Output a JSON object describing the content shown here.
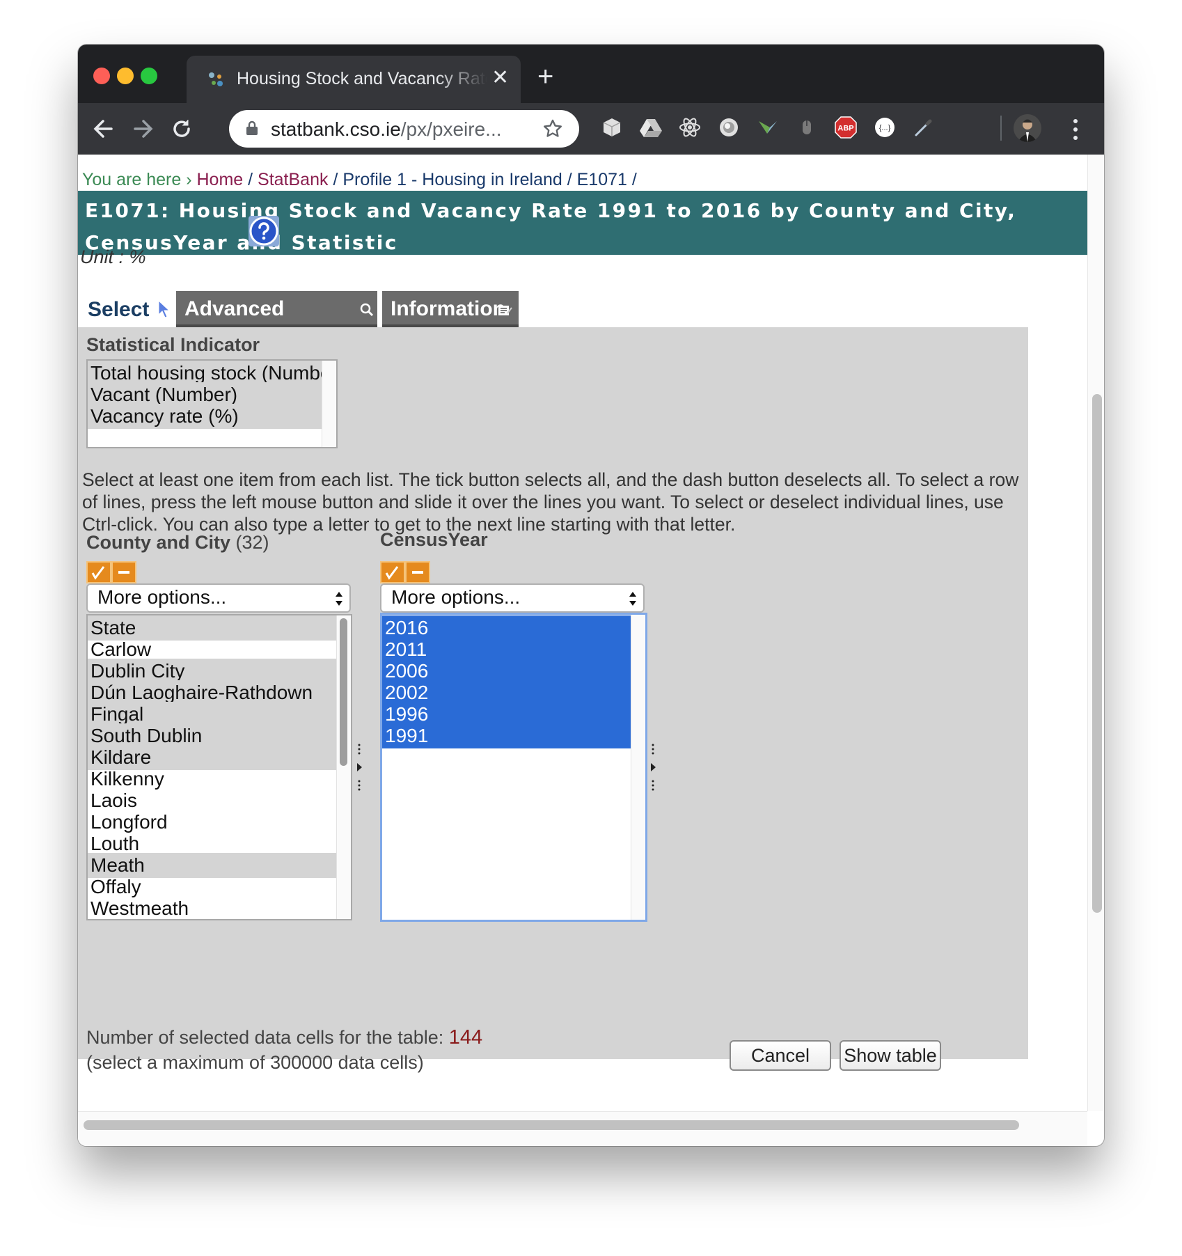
{
  "browser": {
    "tab_title": "Housing Stock and Vacancy Rate",
    "new_tab_symbol": "+",
    "close_symbol": "✕",
    "url_host": "statbank.cso.ie",
    "url_path": "/px/pxeire...",
    "extensions": [
      "cube-icon",
      "drive-icon",
      "react-icon",
      "circle-icon",
      "arrow-icon",
      "mouse-icon",
      "adblock-icon",
      "json-icon",
      "eyedropper-icon"
    ],
    "adblock_label": "ABP",
    "json_label": "{...}"
  },
  "breadcrumb": {
    "prefix": "You are here ›",
    "items": [
      "Home",
      "StatBank",
      "Profile 1 - Housing in Ireland",
      "E1071"
    ],
    "separator": "/"
  },
  "page": {
    "title": "E1071: Housing Stock and Vacancy Rate 1991 to 2016 by County and City, CensusYear and Statistic",
    "unit": "Unit : %"
  },
  "tabs": {
    "select": "Select",
    "advanced": "Advanced selection",
    "information": "Information"
  },
  "statistic": {
    "label": "Statistical Indicator",
    "options": [
      "Total housing stock (Number)",
      "Vacant (Number)",
      "Vacancy rate (%)"
    ]
  },
  "instructions": "Select at least one item from each list. The tick button selects all, and the dash button deselects all. To select a row of lines, press the left mouse button and slide it over the lines you want. To select or deselect individual lines, use Ctrl-click. You can also type a letter to get to the next line starting with that letter.",
  "county": {
    "label": "County and City",
    "count": "(32)",
    "more_options": "More options...",
    "items": [
      "State",
      "Carlow",
      "Dublin City",
      "Dún Laoghaire-Rathdown",
      "Fingal",
      "South Dublin",
      "Kildare",
      "Kilkenny",
      "Laois",
      "Longford",
      "Louth",
      "Meath",
      "Offaly",
      "Westmeath"
    ]
  },
  "census": {
    "label": "CensusYear",
    "more_options": "More options...",
    "items": [
      "2016",
      "2011",
      "2006",
      "2002",
      "1996",
      "1991"
    ]
  },
  "cells": {
    "label": "Number of selected data cells for the table:",
    "value": "144",
    "note": "(select a maximum of 300000 data cells)"
  },
  "buttons": {
    "cancel": "Cancel",
    "show_table": "Show table"
  },
  "colors": {
    "title_bar": "#2f6e72",
    "selected": "#2a6bd6",
    "panel": "#d4d4d4",
    "tick_button": "#e58a1e"
  }
}
